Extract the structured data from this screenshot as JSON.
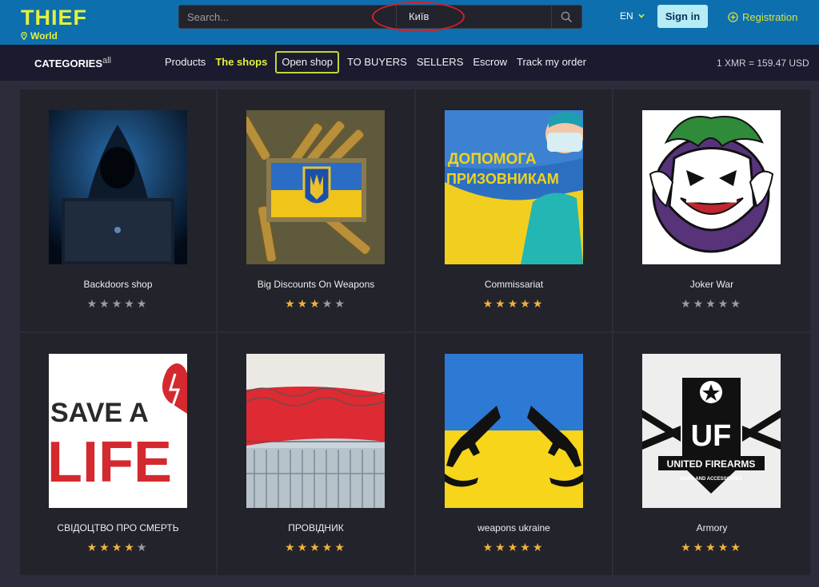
{
  "header": {
    "logo_title": "THIEF",
    "logo_sub": "World",
    "search_placeholder": "Search...",
    "city": "Київ",
    "lang": "EN",
    "signin_label": "Sign in",
    "register_label": "Registration"
  },
  "nav": {
    "categories_label": "CATEGORIES",
    "all_label": "all",
    "links": [
      "Products",
      "The shops",
      "Open shop",
      "TO BUYERS",
      "SELLERS",
      "Escrow",
      "Track my order"
    ],
    "rate": "1 XMR = 159.47 USD"
  },
  "colors": {
    "header_bg": "#0e6fae",
    "nav_bg": "#1a1b2e",
    "accent": "#e3f23a",
    "star": "#f2b23a"
  },
  "shops": [
    {
      "name": "Backdoors shop",
      "rating": 0,
      "image": "hooded-hacker-image"
    },
    {
      "name": "Big Discounts On Weapons",
      "rating": 3,
      "image": "ammo-flag-patch-image"
    },
    {
      "name": "Commissariat",
      "rating": 5,
      "image": "medic-poster-image"
    },
    {
      "name": "Joker War",
      "rating": 0,
      "image": "joker-logo-image"
    },
    {
      "name": "СВІДОЦТВО ПРО СМЕРТЬ",
      "rating": 4,
      "image": "save-a-life-image"
    },
    {
      "name": "ПРОВІДНИК",
      "rating": 5,
      "image": "border-fence-image"
    },
    {
      "name": "weapons ukraine",
      "rating": 5,
      "image": "rifles-flag-image"
    },
    {
      "name": "Armory",
      "rating": 5,
      "image": "united-firearms-logo-image"
    }
  ],
  "image_text": {
    "poster_line1": "ДОПОМОГА",
    "poster_line2": "ПРИЗОВНИКАМ",
    "save_line1": "SAVE A",
    "save_line2": "LIFE",
    "uf_logo": "UF",
    "uf_name": "UNITED FIREARMS",
    "uf_sub": "GUNS AND ACCESSORIES"
  }
}
